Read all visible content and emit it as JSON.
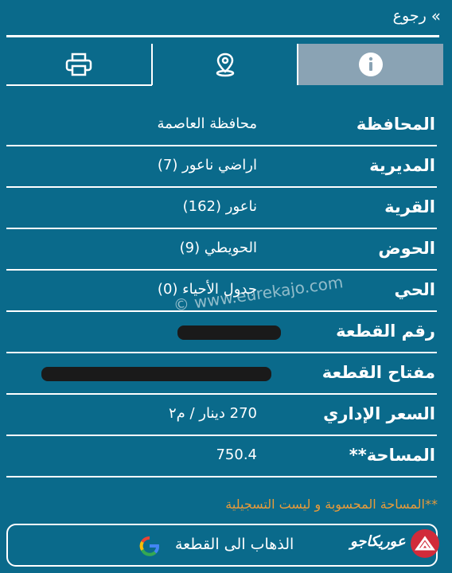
{
  "header": {
    "back_label": "رجوع",
    "back_icon": "double-chevron-right-icon"
  },
  "tabs": [
    {
      "icon": "printer-icon"
    },
    {
      "icon": "location-pin-icon"
    },
    {
      "icon": "info-icon",
      "active": true
    }
  ],
  "details": {
    "rows": [
      {
        "label": "المحافظة",
        "value": "محافظة العاصمة"
      },
      {
        "label": "المديرية",
        "value": "اراضي ناعور (7)"
      },
      {
        "label": "القرية",
        "value": "ناعور (162)"
      },
      {
        "label": "الحوض",
        "value": "الحويطي (9)"
      },
      {
        "label": "الحي",
        "value": "جدول الأحياء (0)"
      },
      {
        "label": "رقم القطعة",
        "value": ""
      },
      {
        "label": "مفتاح القطعة",
        "value": ""
      },
      {
        "label": "السعر الإداري",
        "value": "270 دينار / م٢"
      },
      {
        "label": "المساحة**",
        "value": "750.4"
      }
    ]
  },
  "note": "**المساحة المحسوبة و ليست التسجيلية",
  "go_button": {
    "label": "الذهاب الى القطعة",
    "icon": "google-icon"
  },
  "brand": {
    "logo_text": "عوريكاجو"
  },
  "watermark": "© www.eurekajo.com",
  "colors": {
    "background": "#0a6a8b",
    "active_tab": "#8aa3b4",
    "note": "#e89b3a"
  }
}
